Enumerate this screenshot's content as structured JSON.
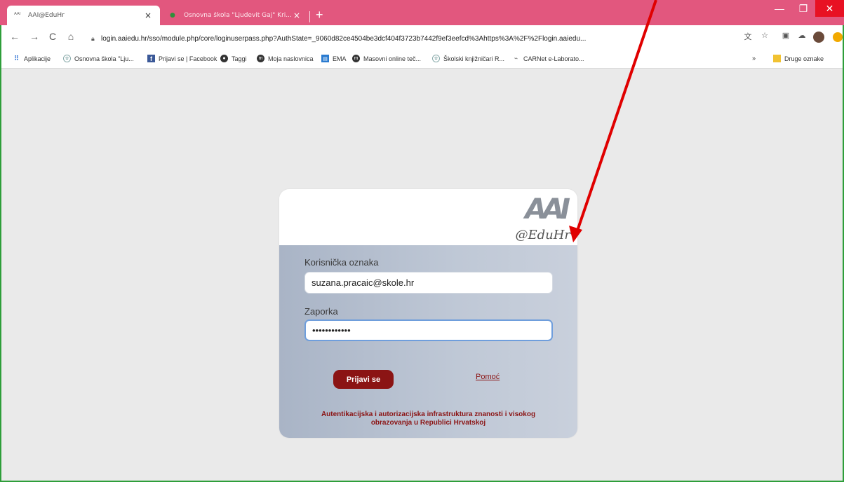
{
  "browser": {
    "tabs": [
      {
        "title": "AAI@EduHr",
        "icon": "aai-favicon"
      },
      {
        "title": "Osnovna škola \"Ljudevit Gaj\" Kri...",
        "icon": "school-favicon"
      }
    ],
    "new_tab": "+",
    "window_controls": {
      "minimize": "—",
      "maximize": "❐",
      "close": "✕"
    },
    "nav": {
      "back": "←",
      "forward": "→",
      "reload": "C",
      "home": "⌂"
    },
    "url": "login.aaiedu.hr/sso/module.php/core/loginuserpass.php?AuthState=_9060d82ce4504be3dcf404f3723b7442f9ef3eefcd%3Ahttps%3A%2F%2Flogin.aaiedu..."
  },
  "bookmarks": {
    "items": [
      {
        "label": "Aplikacije",
        "icon": "apps-grid-icon"
      },
      {
        "label": "Osnovna škola \"Lju...",
        "icon": "school-seal-icon"
      },
      {
        "label": "Prijavi se | Facebook",
        "icon": "facebook-icon"
      },
      {
        "label": "Taggi",
        "icon": "taggi-icon"
      },
      {
        "label": "Moja naslovnica",
        "icon": "moodle-icon"
      },
      {
        "label": "EMA",
        "icon": "ema-icon"
      },
      {
        "label": "Masovni online teč...",
        "icon": "moodle-icon"
      },
      {
        "label": "Školski knjižničari R...",
        "icon": "seal-icon"
      },
      {
        "label": "CARNet e-Laborato...",
        "icon": "carnet-icon"
      }
    ],
    "more": "»",
    "other": "Druge oznake"
  },
  "login": {
    "logo_main": "AAI",
    "logo_sub": "@EduHr",
    "username_label": "Korisnička oznaka",
    "username_value": "suzana.pracaic@skole.hr",
    "password_label": "Zaporka",
    "password_value": "••••••••••••",
    "submit": "Prijavi se",
    "help": "Pomoć",
    "footer": "Autentikacijska i autorizacijska infrastruktura znanosti i visokog obrazovanja u Republici Hrvatskoj"
  },
  "colors": {
    "tabstrip": "#e2577e",
    "accent": "#8b1414",
    "annotation": "#e00000"
  }
}
